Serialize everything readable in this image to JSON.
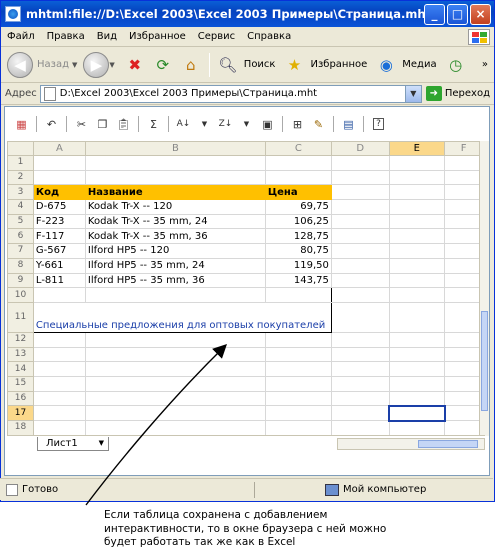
{
  "window": {
    "title": "mhtml:file://D:\\Excel 2003\\Excel 2003 Примеры\\Страница.mht",
    "minimize": "_",
    "maximize": "□",
    "close": "×"
  },
  "menu": {
    "items": [
      "Файл",
      "Правка",
      "Вид",
      "Избранное",
      "Сервис",
      "Справка"
    ]
  },
  "toolbar": {
    "back_label": "Назад",
    "search_label": "Поиск",
    "favorites_label": "Избранное",
    "media_label": "Медиа",
    "more": "»"
  },
  "address": {
    "label": "Адрес",
    "value": "D:\\Excel 2003\\Excel 2003 Примеры\\Страница.mht",
    "go_label": "Переход"
  },
  "sheet": {
    "columns": [
      "A",
      "B",
      "C",
      "D",
      "E",
      "F"
    ],
    "selected_column": "E",
    "selected_row": "17",
    "rows": [
      {
        "n": "1",
        "a": "",
        "b": "",
        "c": ""
      },
      {
        "n": "2",
        "a": "",
        "b": "",
        "c": ""
      },
      {
        "n": "3",
        "a": "Код",
        "b": "Название",
        "c": "Цена",
        "header": true
      },
      {
        "n": "4",
        "a": "D-675",
        "b": "Kodak Tr-X -- 120",
        "c": "69,75"
      },
      {
        "n": "5",
        "a": "F-223",
        "b": "Kodak Tr-X -- 35 mm, 24",
        "c": "106,25"
      },
      {
        "n": "6",
        "a": "F-117",
        "b": "Kodak Tr-X -- 35 mm, 36",
        "c": "128,75"
      },
      {
        "n": "7",
        "a": "G-567",
        "b": "Ilford HP5 -- 120",
        "c": "80,75"
      },
      {
        "n": "8",
        "a": "Y-661",
        "b": "Ilford HP5 -- 35 mm, 24",
        "c": "119,50"
      },
      {
        "n": "9",
        "a": "L-811",
        "b": "Ilford HP5 -- 35 mm, 36",
        "c": "143,75"
      },
      {
        "n": "10",
        "a": "",
        "b": "",
        "c": ""
      },
      {
        "n": "11",
        "a": "",
        "b": "",
        "c": ""
      },
      {
        "n": "12",
        "a": "",
        "b": "",
        "c": ""
      },
      {
        "n": "13",
        "a": "",
        "b": "",
        "c": ""
      },
      {
        "n": "14",
        "a": "",
        "b": "",
        "c": ""
      },
      {
        "n": "15",
        "a": "",
        "b": "",
        "c": ""
      },
      {
        "n": "16",
        "a": "",
        "b": "",
        "c": ""
      },
      {
        "n": "17",
        "a": "",
        "b": "",
        "c": ""
      },
      {
        "n": "18",
        "a": "",
        "b": "",
        "c": ""
      }
    ],
    "offer_text": "Специальные предложения для оптовых покупателей",
    "tab_name": "Лист1"
  },
  "status": {
    "text": "Готово",
    "zone": "Мой компьютер"
  },
  "caption": {
    "lines": [
      "Если таблица сохранена с добавлением",
      "интерактивности, то в окне браузера с ней можно",
      "будет работать так же как в Excel"
    ]
  },
  "colors": {
    "title_bar": "#0a5fd6",
    "header_fill": "#ffc000",
    "selection": "#1a3fa8",
    "link_text": "#1a3ea8"
  }
}
